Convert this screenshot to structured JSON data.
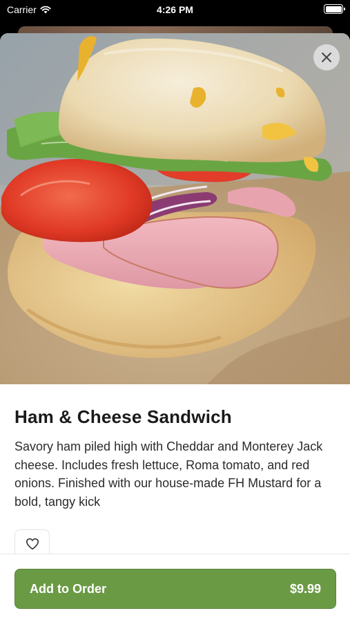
{
  "status_bar": {
    "carrier": "Carrier",
    "time": "4:26 PM"
  },
  "item": {
    "title": "Ham & Cheese Sandwich",
    "description": "Savory ham piled high with Cheddar and Monterey Jack cheese. Includes fresh lettuce, Roma tomato, and red onions. Finished with our house-made FH Mustard for a bold, tangy kick",
    "image_icon": "sandwich-photo"
  },
  "actions": {
    "close_icon": "close-icon",
    "favorite_icon": "heart-outline-icon",
    "add_label": "Add to Order",
    "price": "$9.99"
  },
  "colors": {
    "accent": "#6b9a45",
    "text": "#1a1a1a"
  }
}
